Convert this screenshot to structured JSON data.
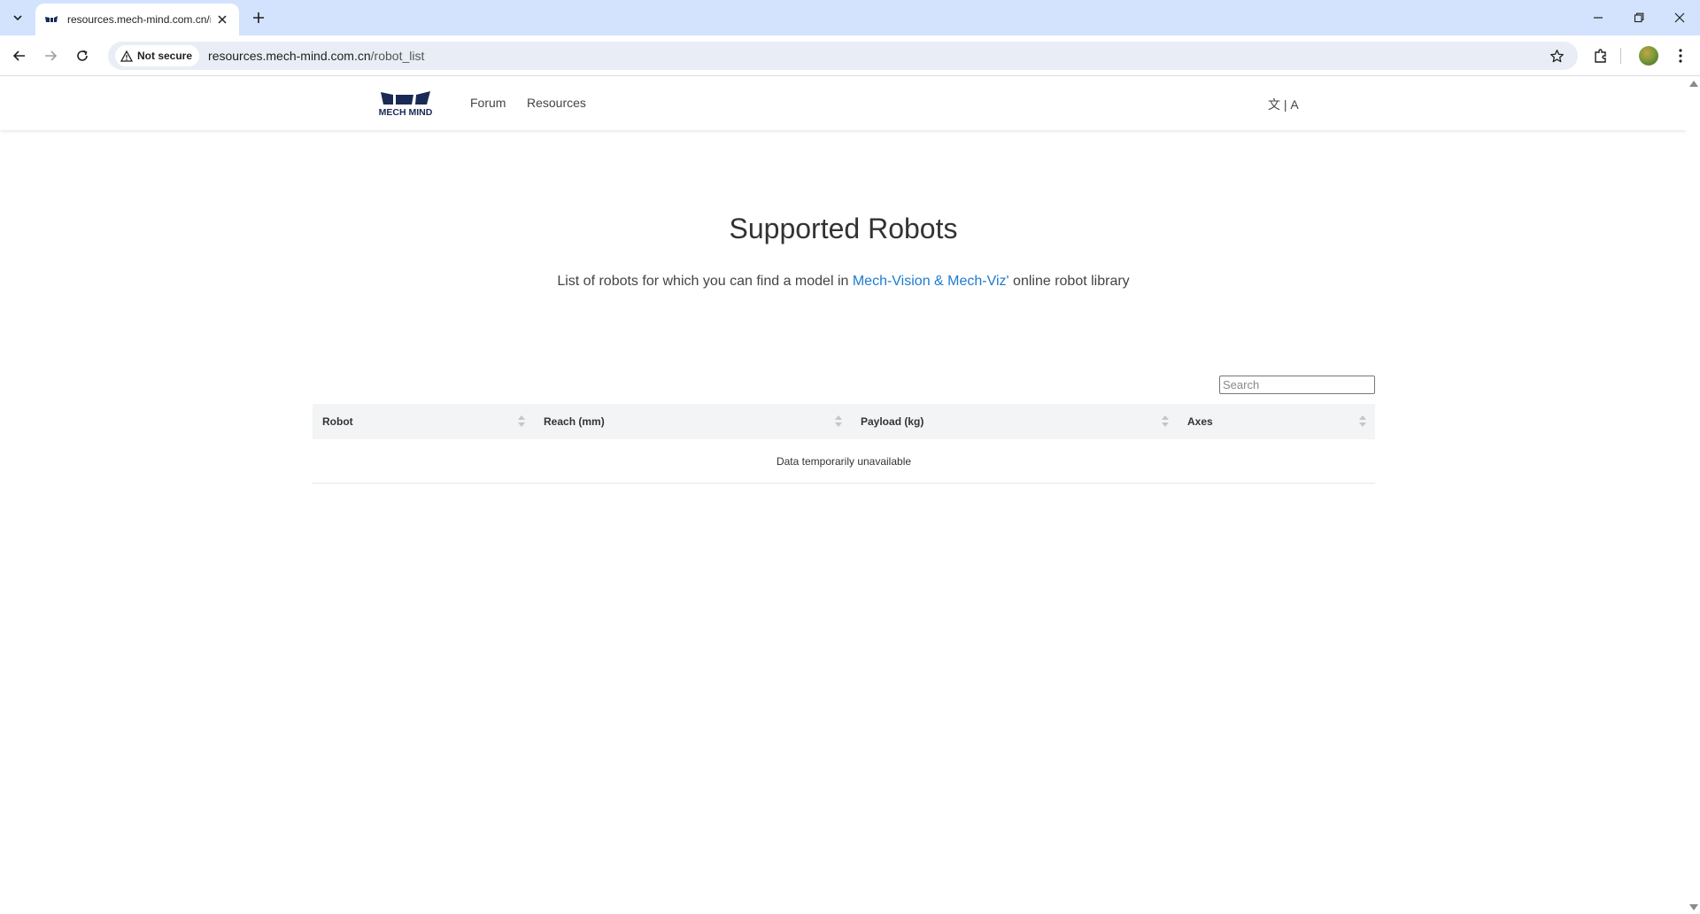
{
  "browser": {
    "tab_title": "resources.mech-mind.com.cn/r",
    "security_label": "Not secure",
    "url_host": "resources.mech-mind.com.cn",
    "url_path": "/robot_list"
  },
  "site": {
    "logo_text": "MECH MIND",
    "nav": [
      {
        "label": "Forum"
      },
      {
        "label": "Resources"
      }
    ],
    "language_toggle": "文 | A"
  },
  "hero": {
    "title": "Supported Robots",
    "subtitle_before": "List of robots for which you can find a model in ",
    "subtitle_link": "Mech-Vision & Mech-Viz'",
    "subtitle_after": " online robot library"
  },
  "table": {
    "search_placeholder": "Search",
    "columns": [
      {
        "label": "Robot"
      },
      {
        "label": "Reach (mm)"
      },
      {
        "label": "Payload (kg)"
      },
      {
        "label": "Axes"
      }
    ],
    "empty_message": "Data temporarily unavailable"
  },
  "colors": {
    "tabbar": "#d3e3fd",
    "link": "#1e7bd1",
    "logo": "#1a2a56"
  }
}
